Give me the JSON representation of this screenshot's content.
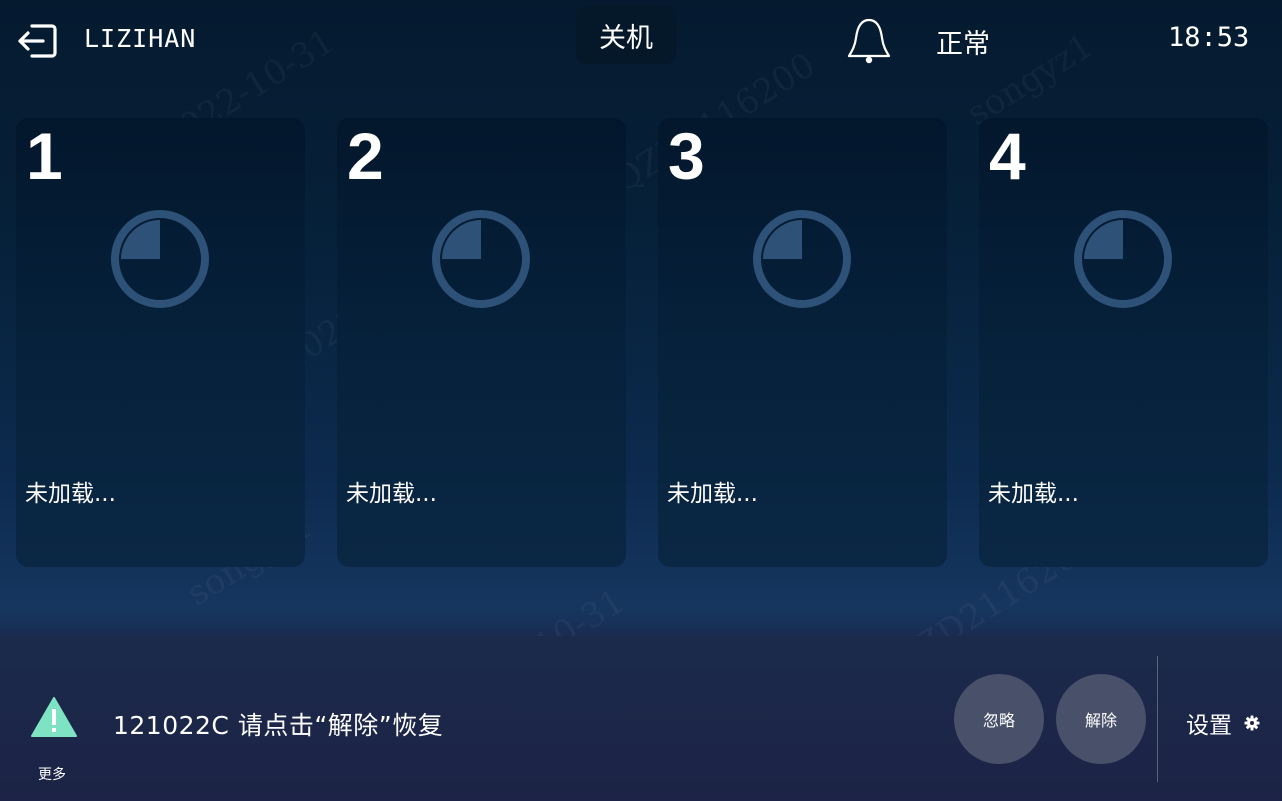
{
  "header": {
    "username": "LIZIHAN",
    "power_label": "关机",
    "status_text": "正常",
    "time": "18:53"
  },
  "slots": [
    {
      "number": "1",
      "status": "未加载..."
    },
    {
      "number": "2",
      "status": "未加载..."
    },
    {
      "number": "3",
      "status": "未加载..."
    },
    {
      "number": "4",
      "status": "未加载..."
    }
  ],
  "footer": {
    "alarm_message": "121022C 请点击“解除”恢复",
    "more_label": "更多",
    "ignore_label": "忽略",
    "release_label": "解除",
    "settings_label": "设置"
  },
  "watermark": {
    "user": "songyz1",
    "date": "2022-10-31",
    "code": "SIJJQZD2116200"
  },
  "colors": {
    "accent_icon": "#2e5178",
    "warning": "#7ee3c3",
    "button_bg": "#48506a"
  }
}
